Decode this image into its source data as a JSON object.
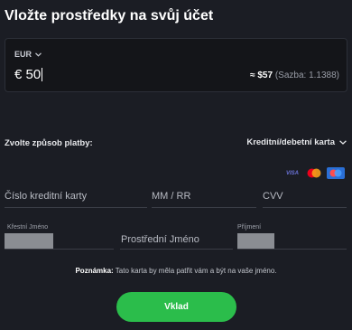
{
  "header": {
    "title": "Vložte prostředky na svůj účet"
  },
  "amount_box": {
    "currency": "EUR",
    "amount": "€ 50",
    "converted": "≈ $57",
    "rate": "(Sazba: 1.1388)"
  },
  "payment": {
    "label": "Zvolte způsob platby:",
    "selected": "Kreditní/debetní karta",
    "logos": {
      "visa": "VISA"
    }
  },
  "card_fields": {
    "number_placeholder": "Číslo kreditní karty",
    "expiry_placeholder": "MM / RR",
    "cvv_placeholder": "CVV"
  },
  "name_fields": {
    "first_label": "Křestní Jméno",
    "middle_placeholder": "Prostřední Jméno",
    "last_label": "Příjmení"
  },
  "note": {
    "label": "Poznámka:",
    "text": " Tato karta by měla patřit vám a být na vaše jméno."
  },
  "submit": {
    "label": "Vklad"
  },
  "colors": {
    "background": "#1b1d24",
    "button": "#2bbd4b",
    "field_border": "#3a3d46"
  }
}
